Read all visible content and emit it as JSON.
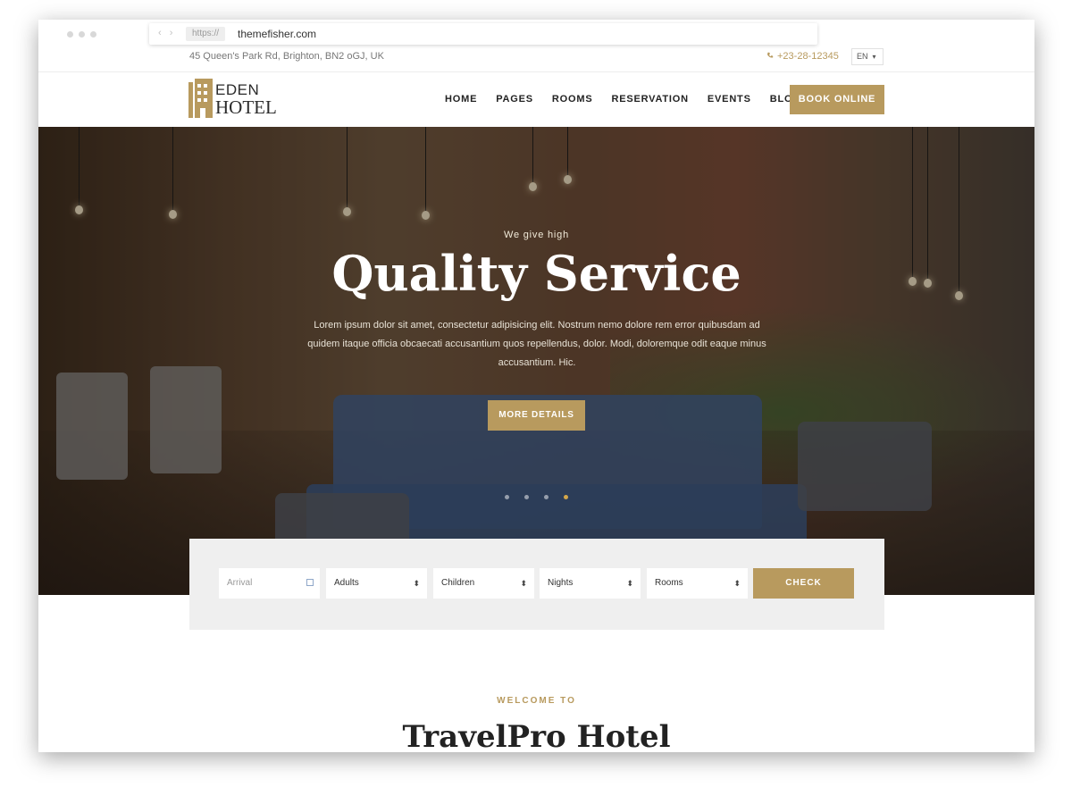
{
  "browser": {
    "protocol": "https://",
    "url": "themefisher.com"
  },
  "topbar": {
    "address": "45 Queen's Park Rd, Brighton, BN2 oGJ, UK",
    "phone": "+23-28-12345",
    "language": "EN"
  },
  "header": {
    "logo_line1": "EDEN",
    "logo_line2": "HOTEL",
    "menu": [
      "HOME",
      "PAGES",
      "ROOMS",
      "RESERVATION",
      "EVENTS",
      "BLOG"
    ],
    "book_label": "BOOK ONLINE"
  },
  "hero": {
    "subtitle": "We give high",
    "title": "Quality Service",
    "text": "Lorem ipsum dolor sit amet, consectetur adipisicing elit. Nostrum nemo dolore rem error quibusdam ad quidem itaque officia obcaecati accusantium quos repellendus, dolor. Modi, doloremque odit eaque minus accusantium. Hic.",
    "button_label": "MORE DETAILS",
    "slide_count": 4,
    "active_slide": 4
  },
  "booking": {
    "arrival_placeholder": "Arrival",
    "adults": "Adults",
    "children": "Children",
    "nights": "Nights",
    "rooms": "Rooms",
    "check_label": "CHECK"
  },
  "welcome": {
    "eyebrow": "WELCOME TO",
    "title": "TravelPro Hotel"
  },
  "colors": {
    "accent": "#b89a5e",
    "active_dot": "#d4a74a"
  }
}
